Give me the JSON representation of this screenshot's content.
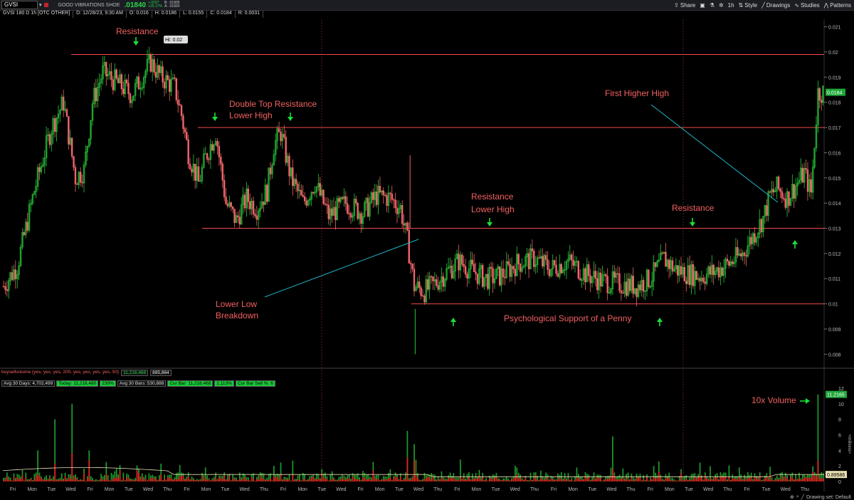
{
  "toolbar": {
    "symbol": "GVSI",
    "company": "GOOD VIBRATIONS SHOE",
    "last": ".01840",
    "change_abs": "+.0037",
    "change_pct": "+25.17%",
    "bid": "B: .01800",
    "ask": "A: .01820",
    "share": "Share",
    "period": "1h",
    "style": "Style",
    "drawings": "Drawings",
    "studies": "Studies",
    "patterns": "Patterns"
  },
  "info": {
    "title": "GVSI 180 D 1h [OTC OTHER]",
    "date": "D: 12/28/23, 9:30 AM",
    "open": "O: 0.016",
    "high": "H: 0.0186",
    "low": "L: 0.0155",
    "close": "C: 0.0184",
    "range": "R: 0.0031"
  },
  "volume_header": {
    "study": "buysellvolume (yes, yes, yes, 200, yes, yes, yes, yes, 50)",
    "v1": "11,216,468",
    "v2": "895,864"
  },
  "stats": {
    "avg30": "Avg 30 Days: 4,702,499",
    "today": "Today: 11,216,480",
    "pct1": "239%",
    "avgbars": "Avg 30 Bars: 530,888",
    "curbar": "Cur Bar: 11,216,468",
    "pct2": "2,113%",
    "cursell": "Cur Bar Sell %: 6"
  },
  "drawing_set": "Drawing set: Default",
  "colors": {
    "up": "#28c83a",
    "down": "#f2656a",
    "hline": "#f14a4a",
    "trend": "#1fb8c9",
    "annot": "#f26060",
    "arrow": "#19e039"
  },
  "chart_data": {
    "type": "candlestick",
    "price_axis": {
      "min": 0.0075,
      "max": 0.0213,
      "ticks": [
        0.008,
        0.009,
        0.01,
        0.011,
        0.012,
        0.013,
        0.014,
        0.015,
        0.016,
        0.017,
        0.018,
        0.019,
        0.02,
        0.021
      ],
      "tick_labels": [
        "0.008",
        "0.009",
        "0.01",
        "0.011",
        "0.012",
        "0.013",
        "0.014",
        "0.015",
        "0.016",
        "0.017",
        "0.018",
        "0.019",
        "0.02",
        "0.021"
      ]
    },
    "last_price_label": "0.0184",
    "horizontal_levels": [
      0.0199,
      0.017,
      0.013,
      0.01
    ],
    "annotations": [
      {
        "text": "Resistance",
        "x": 0.055,
        "y": 0.0207
      },
      {
        "text": "Hi: 0.02",
        "x": 0.063,
        "y": 0.0203
      },
      {
        "text": "Double Top Resistance",
        "x": 0.103,
        "y": 0.0178
      },
      {
        "text": "Lower High",
        "x": 0.103,
        "y": 0.0174
      },
      {
        "text": "Resistance",
        "x": 0.225,
        "y": 0.0141
      },
      {
        "text": "Lower High",
        "x": 0.225,
        "y": 0.0137
      },
      {
        "text": "Lower Low",
        "x": 0.102,
        "y": 0.011
      },
      {
        "text": "Breakdown",
        "x": 0.102,
        "y": 0.0106
      },
      {
        "text": "Psychological Support of a Penny",
        "x": 0.285,
        "y": 0.0098
      },
      {
        "text": "Resistance",
        "x": 0.33,
        "y": 0.0137
      },
      {
        "text": "First Higher High",
        "x": 0.31,
        "y": 0.0179
      },
      {
        "text": "10x Volume",
        "x": 0.385,
        "y": 0.0
      }
    ],
    "candles_hint": "hourly OHLC reconstructed approximately from key levels",
    "path_points": [
      [
        0,
        0.0107
      ],
      [
        8,
        0.0115
      ],
      [
        18,
        0.0145
      ],
      [
        28,
        0.017
      ],
      [
        35,
        0.018
      ],
      [
        42,
        0.015
      ],
      [
        47,
        0.0153
      ],
      [
        52,
        0.018
      ],
      [
        58,
        0.0192
      ],
      [
        66,
        0.0188
      ],
      [
        75,
        0.0183
      ],
      [
        86,
        0.0196
      ],
      [
        92,
        0.019
      ],
      [
        100,
        0.0186
      ],
      [
        104,
        0.0175
      ],
      [
        108,
        0.016
      ],
      [
        114,
        0.0148
      ],
      [
        118,
        0.0158
      ],
      [
        124,
        0.0168
      ],
      [
        130,
        0.014
      ],
      [
        136,
        0.0133
      ],
      [
        142,
        0.0142
      ],
      [
        148,
        0.0138
      ],
      [
        154,
        0.0145
      ],
      [
        158,
        0.0163
      ],
      [
        162,
        0.0168
      ],
      [
        168,
        0.015
      ],
      [
        175,
        0.014
      ],
      [
        182,
        0.0148
      ],
      [
        190,
        0.0135
      ],
      [
        200,
        0.014
      ],
      [
        210,
        0.0136
      ],
      [
        218,
        0.0143
      ],
      [
        226,
        0.0142
      ],
      [
        232,
        0.0138
      ],
      [
        236,
        0.0125
      ],
      [
        240,
        0.0107
      ],
      [
        246,
        0.0105
      ],
      [
        252,
        0.0108
      ],
      [
        258,
        0.0112
      ],
      [
        266,
        0.0117
      ],
      [
        274,
        0.0113
      ],
      [
        282,
        0.011
      ],
      [
        290,
        0.0111
      ],
      [
        300,
        0.0116
      ],
      [
        310,
        0.0118
      ],
      [
        320,
        0.0114
      ],
      [
        330,
        0.0117
      ],
      [
        340,
        0.0112
      ],
      [
        350,
        0.0109
      ],
      [
        360,
        0.0108
      ],
      [
        370,
        0.0107
      ],
      [
        378,
        0.011
      ],
      [
        386,
        0.0118
      ],
      [
        392,
        0.0114
      ],
      [
        400,
        0.0112
      ],
      [
        408,
        0.0111
      ],
      [
        416,
        0.0113
      ],
      [
        424,
        0.0116
      ],
      [
        432,
        0.012
      ],
      [
        438,
        0.0127
      ],
      [
        444,
        0.0134
      ],
      [
        448,
        0.0143
      ],
      [
        452,
        0.0146
      ],
      [
        458,
        0.0142
      ],
      [
        464,
        0.0148
      ],
      [
        468,
        0.0152
      ],
      [
        472,
        0.0144
      ],
      [
        476,
        0.0184
      ]
    ],
    "volume_axis": {
      "min": 0,
      "max": 12,
      "ticks": [
        0,
        2,
        4,
        6,
        8,
        10,
        12
      ],
      "tick_labels": [
        "0",
        "2",
        "4",
        "6",
        "8",
        "10",
        "12"
      ],
      "unit": "<millions>"
    },
    "volume_last_label": "11.2165",
    "volume_avg_label": "0.89586",
    "volume_spikes": [
      [
        20,
        4
      ],
      [
        30,
        8
      ],
      [
        40,
        10
      ],
      [
        50,
        4
      ],
      [
        60,
        2.5
      ],
      [
        92,
        2.3
      ],
      [
        118,
        1.8
      ],
      [
        158,
        2.0
      ],
      [
        186,
        1.6
      ],
      [
        236,
        6.5
      ],
      [
        240,
        4.8
      ],
      [
        256,
        1.3
      ],
      [
        300,
        1.8
      ],
      [
        340,
        1.2
      ],
      [
        356,
        5.8
      ],
      [
        396,
        1.6
      ],
      [
        430,
        1.8
      ],
      [
        448,
        1.9
      ],
      [
        476,
        11.2
      ]
    ],
    "x_labels": [
      "Fri",
      "Mon",
      "Tue",
      "Wed",
      "Fri",
      "Mon",
      "Tue",
      "Wed",
      "Thu",
      "Fri",
      "Mon",
      "Tue",
      "Wed",
      "Thu",
      "Fri",
      "Mon",
      "Tue",
      "Wed",
      "Fri",
      "Mon",
      "Tue",
      "Wed",
      "Thu",
      "Fri",
      "Mon",
      "Tue",
      "Wed",
      "Thu",
      "Fri",
      "Mon",
      "Tue",
      "Wed",
      "Thu",
      "Fri",
      "Mon",
      "Tue",
      "Wed",
      "Thu",
      "Fri",
      "Tue",
      "Wed",
      "Thu"
    ]
  }
}
